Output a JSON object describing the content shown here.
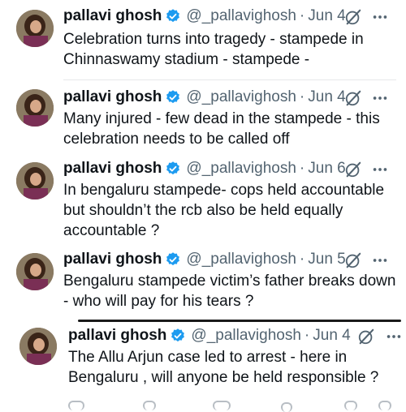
{
  "tweets": [
    {
      "author": {
        "name": "pallavi ghosh",
        "handle": "@_pallavighosh"
      },
      "separator": "·",
      "date": "Jun 4",
      "text": "Celebration turns into tragedy - stampede in\nChinnaswamy stadium - stampede -"
    },
    {
      "author": {
        "name": "pallavi ghosh",
        "handle": "@_pallavighosh"
      },
      "separator": "·",
      "date": "Jun 4",
      "text": "Many injured - few dead in the stampede - this\ncelebration needs to be called off"
    },
    {
      "author": {
        "name": "pallavi ghosh",
        "handle": "@_pallavighosh"
      },
      "separator": "·",
      "date": "Jun 6",
      "text": "In bengaluru stampede- cops held accountable\nbut shouldn’t the rcb also be held equally\naccountable ?"
    },
    {
      "author": {
        "name": "pallavi ghosh",
        "handle": "@_pallavighosh"
      },
      "separator": "·",
      "date": "Jun 5",
      "text": "Bengaluru stampede victim’s father breaks down\n- who will pay for his tears ?"
    },
    {
      "author": {
        "name": "pallavi ghosh",
        "handle": "@_pallavighosh"
      },
      "separator": "·",
      "date": "Jun 4",
      "text": "The Allu Arjun case led to arrest - here in\nBengaluru , will anyone be held responsible ?"
    }
  ],
  "icons": {
    "verified": "verified-badge-icon",
    "grok": "grok-slash-icon",
    "more": "more-options-icon"
  },
  "colors": {
    "verified_blue": "#1d9bf0",
    "text": "#0f1419",
    "secondary": "#536471"
  }
}
